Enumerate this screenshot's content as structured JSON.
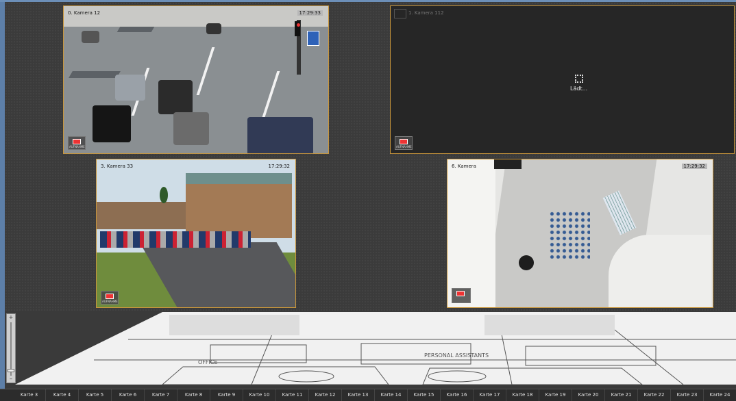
{
  "cameras": [
    {
      "title": "0. Kamera 12",
      "time": "17:29:33",
      "rec_label": "AUFNAHME"
    },
    {
      "title": "1. Kamera 112",
      "status": "Lädt...",
      "rec_label": "AUFNAHME"
    },
    {
      "title": "3. Kamera 33",
      "time": "17:29:32",
      "rec_label": "AUFNAHME"
    },
    {
      "title": "6. Kamera",
      "time": "17:29:32"
    }
  ],
  "floor_plan": {
    "room_labels": [
      "OFFICE",
      "PERSONAL ASSISTANTS"
    ]
  },
  "zoom": {
    "plus": "+",
    "minus": "–"
  },
  "map_tabs": [
    "Karte 3",
    "Karte 4",
    "Karte 5",
    "Karte 6",
    "Karte 7",
    "Karte 8",
    "Karte 9",
    "Karte 10",
    "Karte 11",
    "Karte 12",
    "Karte 13",
    "Karte 14",
    "Karte 15",
    "Karte 16",
    "Karte 17",
    "Karte 18",
    "Karte 19",
    "Karte 20",
    "Karte 21",
    "Karte 22",
    "Karte 23",
    "Karte 24"
  ],
  "colors": {
    "frame_border": "#c9963b",
    "accent_strip": "#5d7fa8",
    "record": "#e33333"
  }
}
